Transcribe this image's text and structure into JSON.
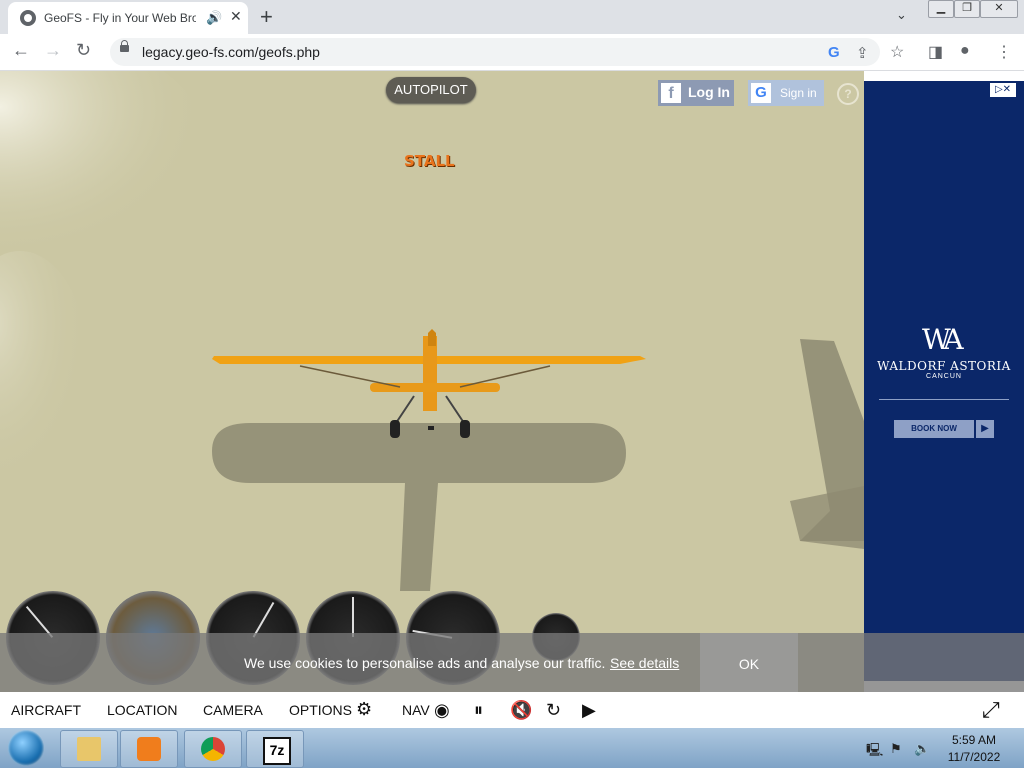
{
  "browser": {
    "tab_title": "GeoFS - Fly in Your Web Bro",
    "url": "legacy.geo-fs.com/geofs.php",
    "window_controls": [
      "minimize",
      "restore",
      "close"
    ]
  },
  "game": {
    "autopilot_label": "AUTOPILOT",
    "stall_warning": "STALL",
    "facebook_login": "Log In",
    "google_signin": "Sign in",
    "help_label": "?"
  },
  "ad": {
    "brand": "WALDORF ASTORIA",
    "location": "CANCUN",
    "cta": "BOOK NOW"
  },
  "cookie_banner": {
    "message": "We use cookies to personalise ads and analyse our traffic.",
    "link": "See details",
    "ok": "OK"
  },
  "bottom_menu": {
    "aircraft": "AIRCRAFT",
    "location": "LOCATION",
    "camera": "CAMERA",
    "options": "OPTIONS",
    "nav": "NAV"
  },
  "taskbar": {
    "time": "5:59 AM",
    "date": "11/7/2022",
    "apps": [
      "file-explorer",
      "media-player",
      "chrome",
      "7-zip"
    ]
  }
}
